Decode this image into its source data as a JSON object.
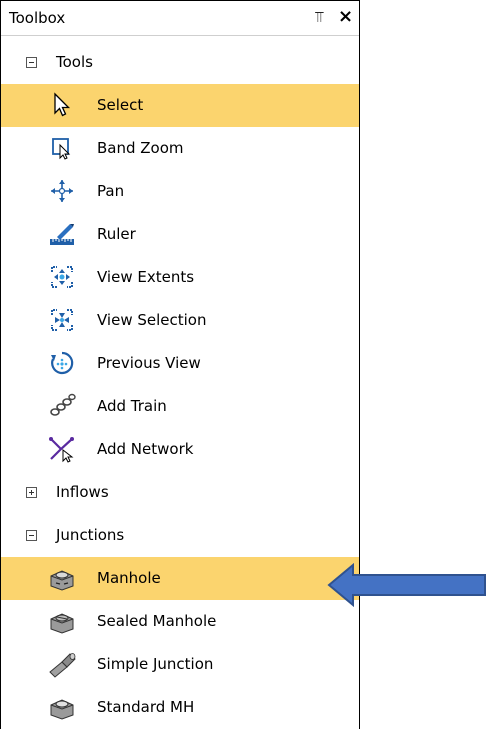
{
  "toolbox": {
    "title": "Toolbox",
    "pin_glyph": "⫪",
    "close_glyph": "×"
  },
  "groups": {
    "tools": {
      "label": "Tools",
      "expanded": true,
      "items": [
        {
          "label": "Select",
          "icon": "cursor-arrow-icon",
          "selected": true
        },
        {
          "label": "Band Zoom",
          "icon": "band-zoom-icon"
        },
        {
          "label": "Pan",
          "icon": "pan-arrows-icon"
        },
        {
          "label": "Ruler",
          "icon": "ruler-icon"
        },
        {
          "label": "View Extents",
          "icon": "view-extents-icon"
        },
        {
          "label": "View Selection",
          "icon": "view-selection-icon"
        },
        {
          "label": "Previous View",
          "icon": "previous-view-icon"
        },
        {
          "label": "Add Train",
          "icon": "add-train-icon"
        },
        {
          "label": "Add Network",
          "icon": "add-network-icon"
        }
      ]
    },
    "inflows": {
      "label": "Inflows",
      "expanded": false
    },
    "junctions": {
      "label": "Junctions",
      "expanded": true,
      "items": [
        {
          "label": "Manhole",
          "icon": "manhole-icon",
          "selected": true
        },
        {
          "label": "Sealed Manhole",
          "icon": "sealed-manhole-icon"
        },
        {
          "label": "Simple Junction",
          "icon": "simple-junction-icon"
        },
        {
          "label": "Standard MH",
          "icon": "standard-mh-icon"
        }
      ]
    }
  },
  "colors": {
    "selected_row": "#fbd46e",
    "arrow_fill": "#4472c4",
    "arrow_stroke": "#2f528f"
  }
}
